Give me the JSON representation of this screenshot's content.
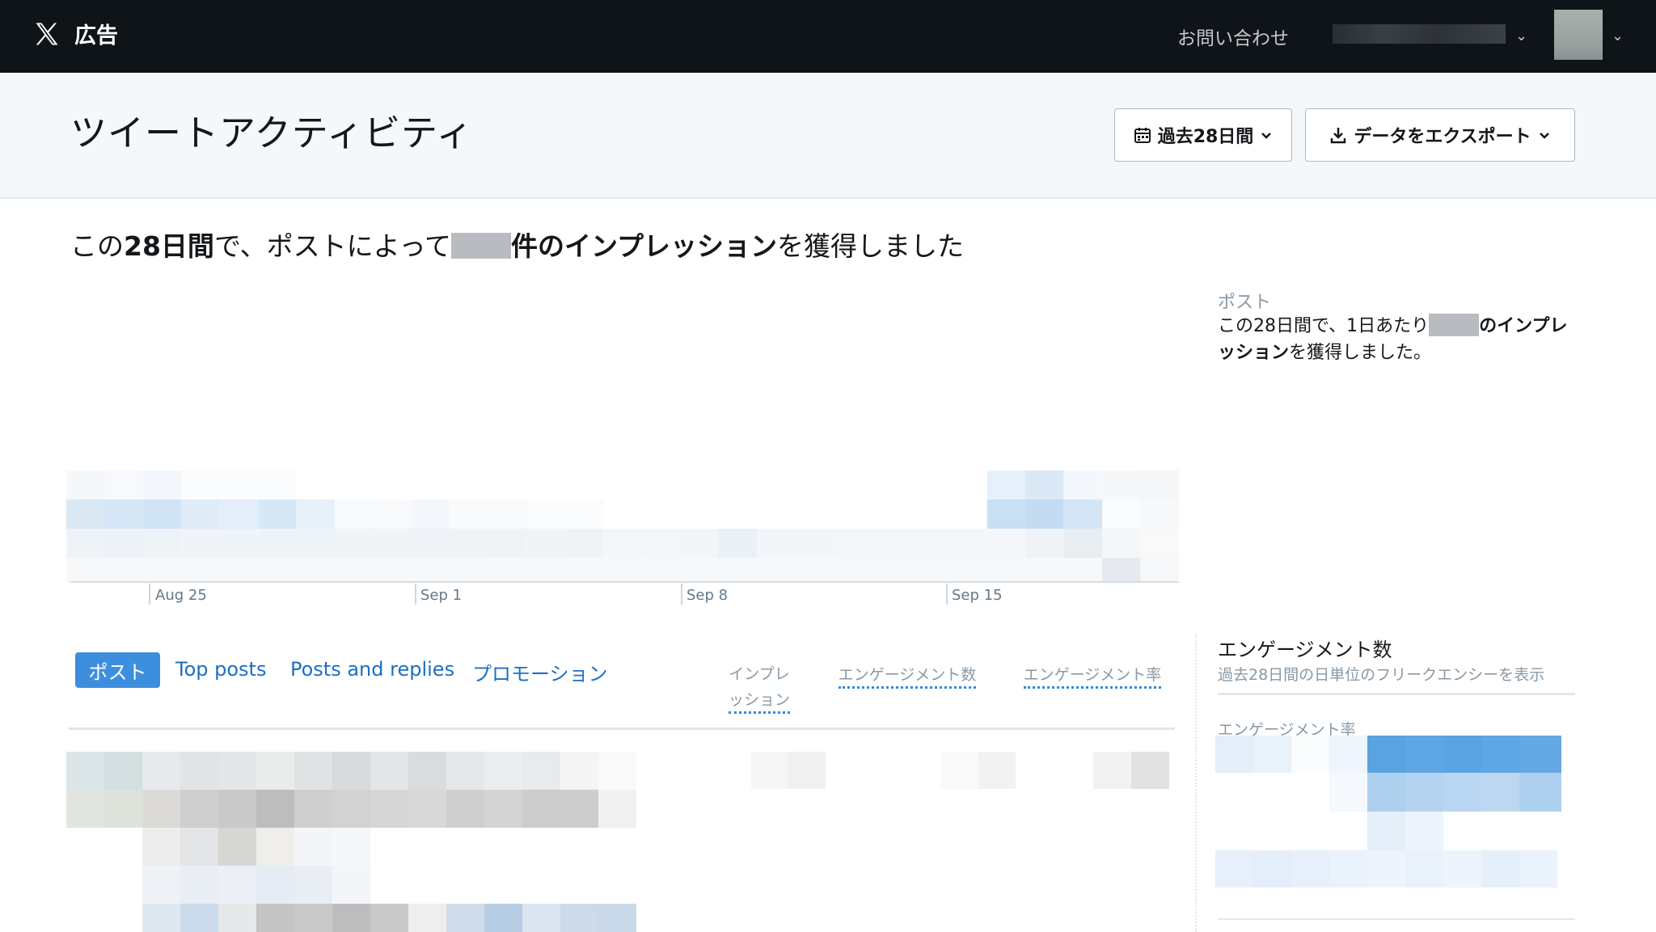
{
  "app": {
    "brand_label": "広告",
    "contact_label": "お問い合わせ"
  },
  "header": {
    "title": "ツイートアクティビティ",
    "range_button": "過去28日間",
    "export_button": "データをエクスポート"
  },
  "summary": {
    "prefix": "この",
    "period": "28日間",
    "middle": "で、ポストによって",
    "suffix_bold": "件のインプレッション",
    "suffix": "を獲得しました"
  },
  "side_panel": {
    "label": "ポスト",
    "text_prefix": "この28日間で、1日あたり",
    "text_bold": "のインプレッション",
    "text_suffix": "を獲得しました。"
  },
  "chart_data": {
    "type": "bar",
    "x_ticks": [
      "Aug 25",
      "Sep 1",
      "Sep 8",
      "Sep 15"
    ]
  },
  "tabs": [
    {
      "label": "ポスト",
      "active": true
    },
    {
      "label": "Top posts",
      "active": false
    },
    {
      "label": "Posts and replies",
      "active": false
    },
    {
      "label": "プロモーション",
      "active": false
    }
  ],
  "columns": {
    "impressions_line1": "インプレ",
    "impressions_line2": "ッション",
    "engagements": "エンゲージメント数",
    "engagement_rate": "エンゲージメント率"
  },
  "engagement_panel": {
    "title": "エンゲージメント数",
    "subtitle": "過去28日間の日単位のフリークエンシーを表示",
    "rate_label": "エンゲージメント率"
  },
  "colors": {
    "topbar": "#0f1419",
    "accent": "#3e8ede",
    "link": "#1b6fc4"
  }
}
